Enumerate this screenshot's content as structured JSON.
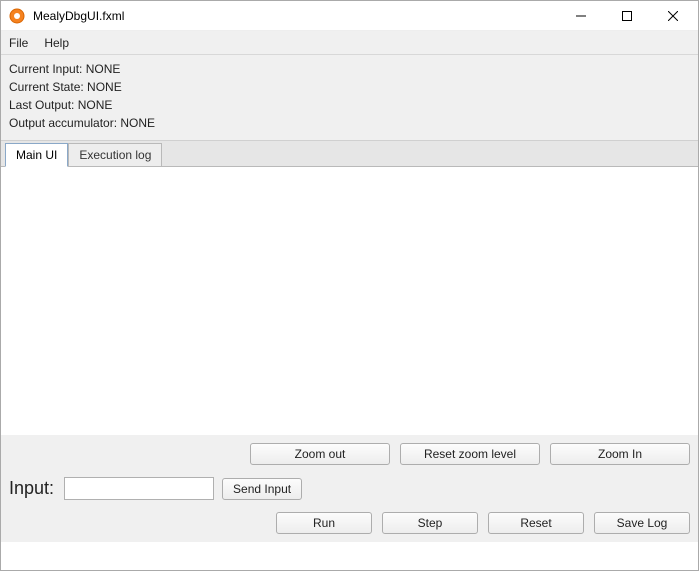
{
  "window": {
    "title": "MealyDbgUI.fxml"
  },
  "menu": {
    "file": "File",
    "help": "Help"
  },
  "status": {
    "current_input_label": "Current Input: ",
    "current_input_value": "NONE",
    "current_state_label": "Current State: ",
    "current_state_value": "NONE",
    "last_output_label": "Last Output: ",
    "last_output_value": "NONE",
    "accumulator_label": "Output accumulator: ",
    "accumulator_value": "NONE"
  },
  "tabs": {
    "main_ui": "Main UI",
    "execution_log": "Execution log"
  },
  "buttons": {
    "zoom_out": "Zoom out",
    "reset_zoom": "Reset zoom level",
    "zoom_in": "Zoom In",
    "send_input": "Send Input",
    "run": "Run",
    "step": "Step",
    "reset": "Reset",
    "save_log": "Save Log"
  },
  "input": {
    "label": "Input:",
    "value": ""
  }
}
